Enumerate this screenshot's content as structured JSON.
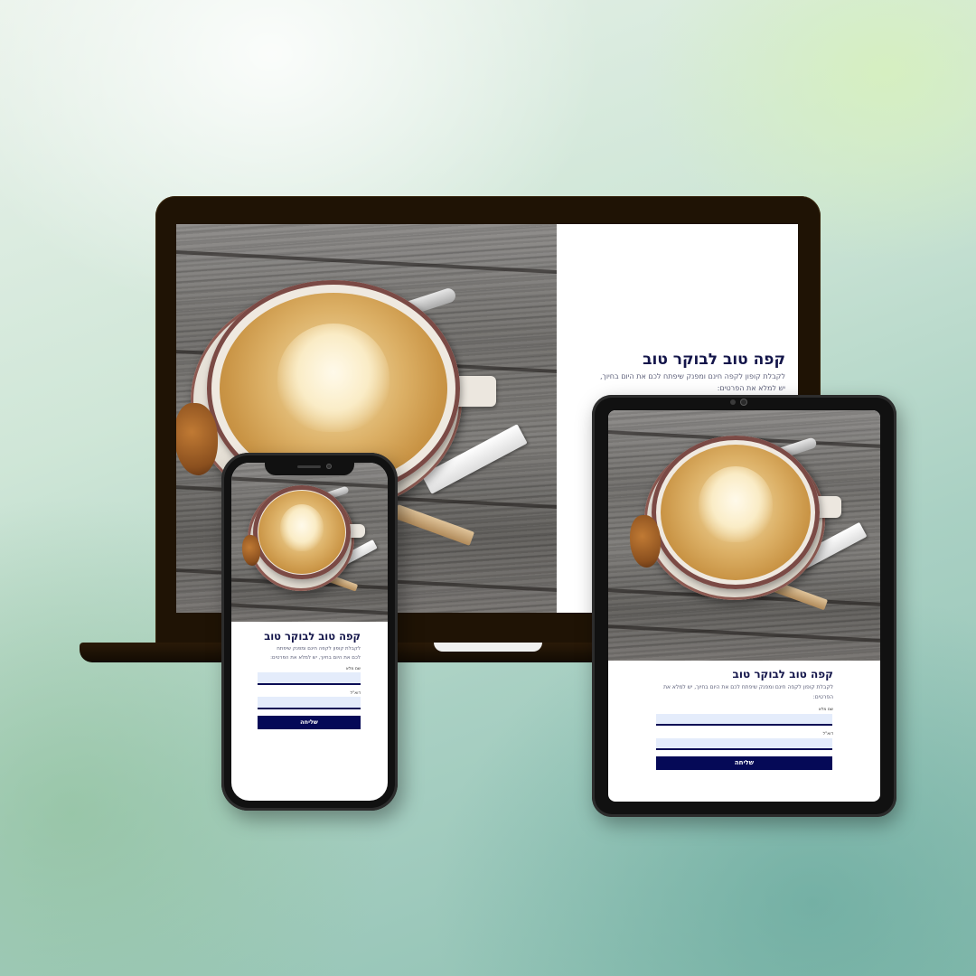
{
  "brand_colors": {
    "navy": "#050957",
    "title": "#13154a",
    "field_bg": "#e4ecfb"
  },
  "laptop": {
    "title": "קפה טוב לבוקר טוב",
    "text_line1": "לקבלת קופון לקפה חינם ומפנק שיפתח לכם את היום בחיוך,",
    "text_line2": "יש למלא את הפרטים:"
  },
  "phone": {
    "title": "קפה טוב לבוקר טוב",
    "text_line1": "לקבלת קופון לקפה חינם ומפנק שיפתח",
    "text_line2": "לכם את היום בחיוך, יש למלא את הפרטים:",
    "name_label": "שם מלא",
    "email_label": "דוא\"ל",
    "submit_label": "שליחה"
  },
  "tablet": {
    "title": "קפה טוב לבוקר טוב",
    "text_line1": "לקבלת קופון לקפה חינם ומפנק שיפתח לכם את היום בחיוך, יש למלא את",
    "text_line2": "הפרטים:",
    "name_label": "שם מלא",
    "email_label": "דוא\"ל",
    "submit_label": "שליחה"
  }
}
